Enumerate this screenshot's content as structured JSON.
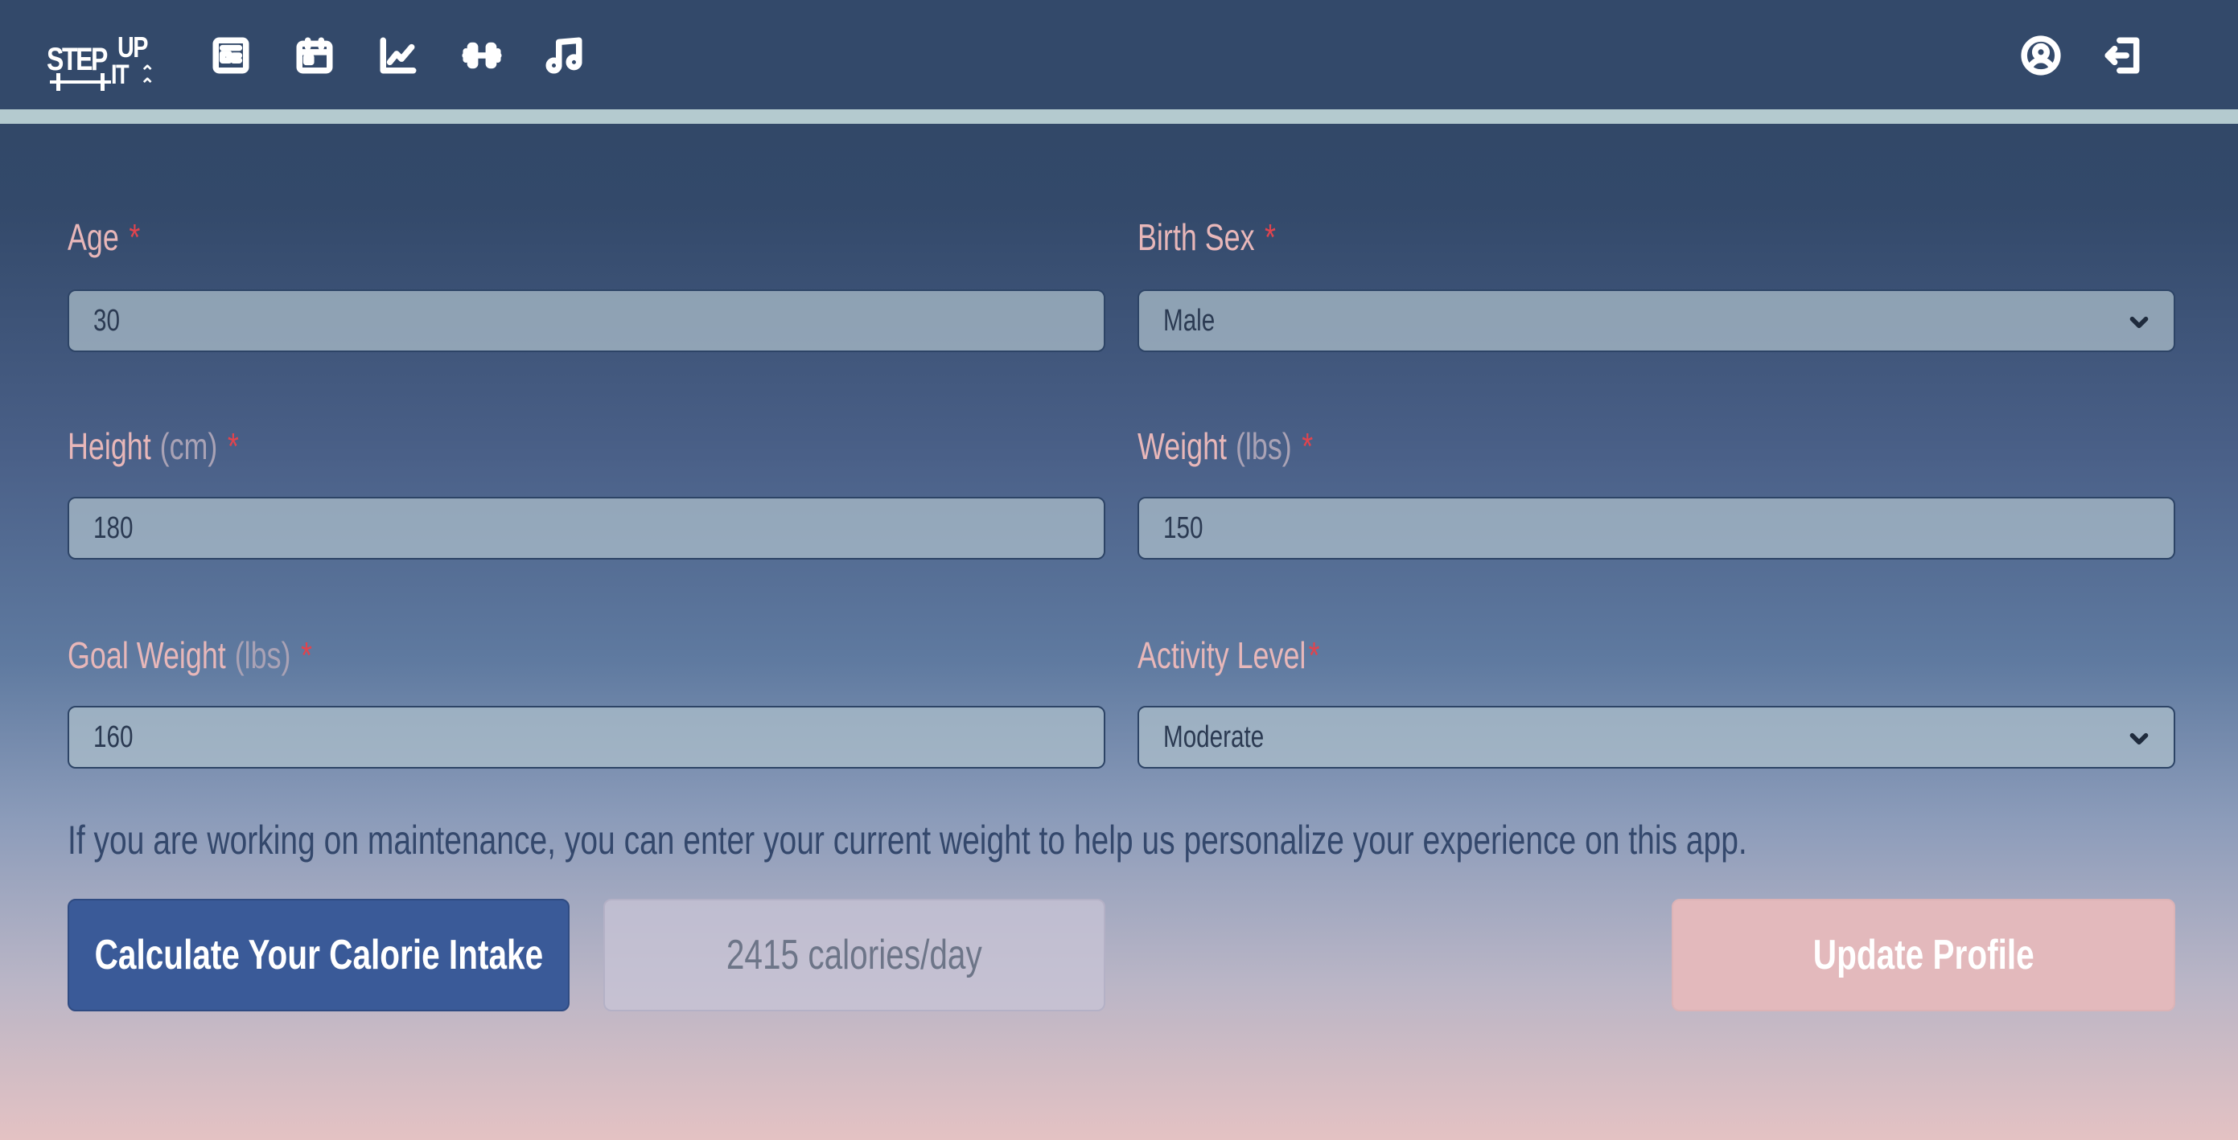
{
  "app": {
    "logo": {
      "line1": "STEP",
      "line2": "UP",
      "line3": "IT"
    }
  },
  "nav": {
    "icons": [
      "journal-icon",
      "calendar-icon",
      "chart-icon",
      "dumbbell-icon",
      "music-icon"
    ],
    "right_icons": [
      "profile-icon",
      "logout-icon"
    ]
  },
  "form": {
    "age": {
      "label": "Age",
      "required": "*",
      "value": "30"
    },
    "birth_sex": {
      "label": "Birth Sex",
      "required": "*",
      "value": "Male"
    },
    "height": {
      "label": "Height",
      "unit": "(cm)",
      "required": "*",
      "value": "180"
    },
    "weight": {
      "label": "Weight",
      "unit": "(lbs)",
      "required": "*",
      "value": "150"
    },
    "goal_weight": {
      "label": "Goal Weight",
      "unit": "(lbs)",
      "required": "*",
      "value": "160"
    },
    "activity_level": {
      "label": "Activity Level",
      "required": "*",
      "value": "Moderate"
    }
  },
  "note": "If you are working on maintenance, you can enter your current weight to help us personalize your experience on this app.",
  "actions": {
    "calculate_label": "Calculate Your Calorie Intake",
    "result": "2415 calories/day",
    "update_label": "Update Profile"
  },
  "colors": {
    "navbar": "#33496a",
    "accent_bar": "#b4cacf",
    "label": "#e8b7b9",
    "required": "#e0444e",
    "calc_button": "#3a5a98",
    "update_button": "#e3b9bc"
  }
}
